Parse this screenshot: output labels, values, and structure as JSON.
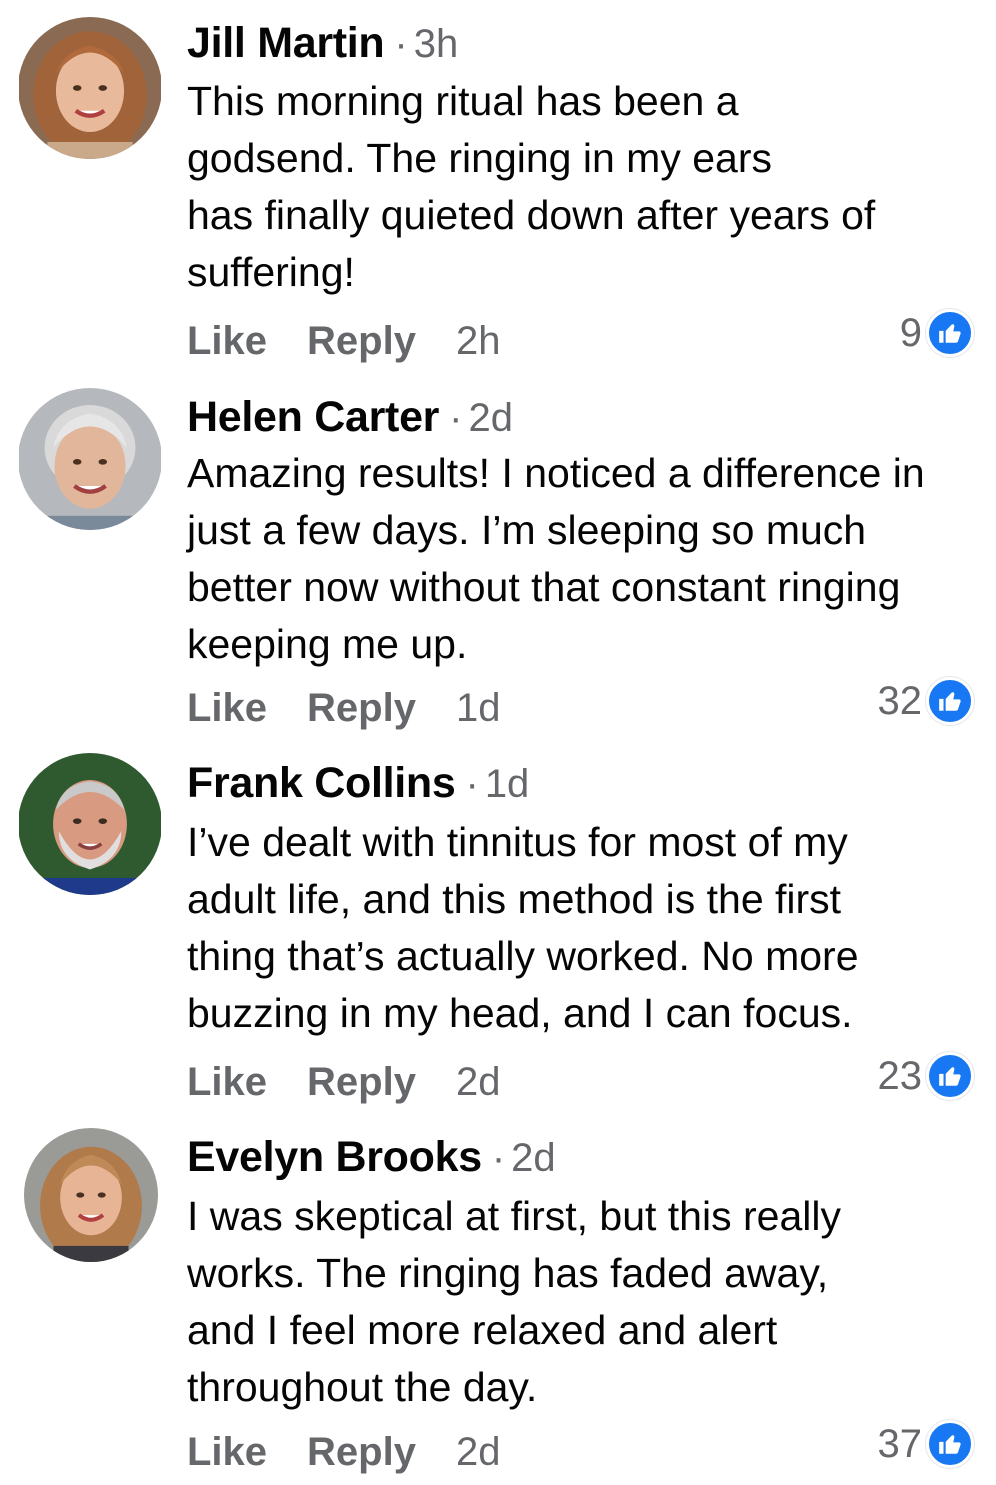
{
  "colors": {
    "name": "#050505",
    "meta": "#65676b",
    "like_blue": "#1877f2"
  },
  "comments": [
    {
      "name": "Jill Martin",
      "separator": "·",
      "time": "3h",
      "lines": [
        "This morning ritual has been a",
        "godsend. The ringing in my ears",
        "has finally quieted down after years of",
        "suffering!"
      ],
      "like_label": "Like",
      "reply_label": "Reply",
      "action_time": "2h",
      "reaction_count": "9",
      "reaction_icon": "thumbs-up-icon"
    },
    {
      "name": "Helen Carter",
      "separator": "·",
      "time": "2d",
      "lines": [
        "Amazing results! I noticed a difference in",
        "just a few days. I’m sleeping so much",
        "better now without that constant ringing",
        "keeping me up."
      ],
      "like_label": "Like",
      "reply_label": "Reply",
      "action_time": "1d",
      "reaction_count": "32",
      "reaction_icon": "thumbs-up-icon"
    },
    {
      "name": "Frank Collins",
      "separator": "·",
      "time": "1d",
      "lines": [
        "I’ve dealt with tinnitus for most of my",
        "adult life, and this method is the first",
        "thing that’s actually worked. No more",
        "buzzing in my head, and I can focus."
      ],
      "like_label": "Like",
      "reply_label": "Reply",
      "action_time": "2d",
      "reaction_count": "23",
      "reaction_icon": "thumbs-up-icon"
    },
    {
      "name": "Evelyn Brooks",
      "separator": "·",
      "time": "2d",
      "lines": [
        "I was skeptical  at first, but this really",
        "works. The ringing has faded away,",
        "and I feel more relaxed and alert",
        "throughout the day."
      ],
      "like_label": "Like",
      "reply_label": "Reply",
      "action_time": "2d",
      "reaction_count": "37",
      "reaction_icon": "thumbs-up-icon"
    }
  ]
}
